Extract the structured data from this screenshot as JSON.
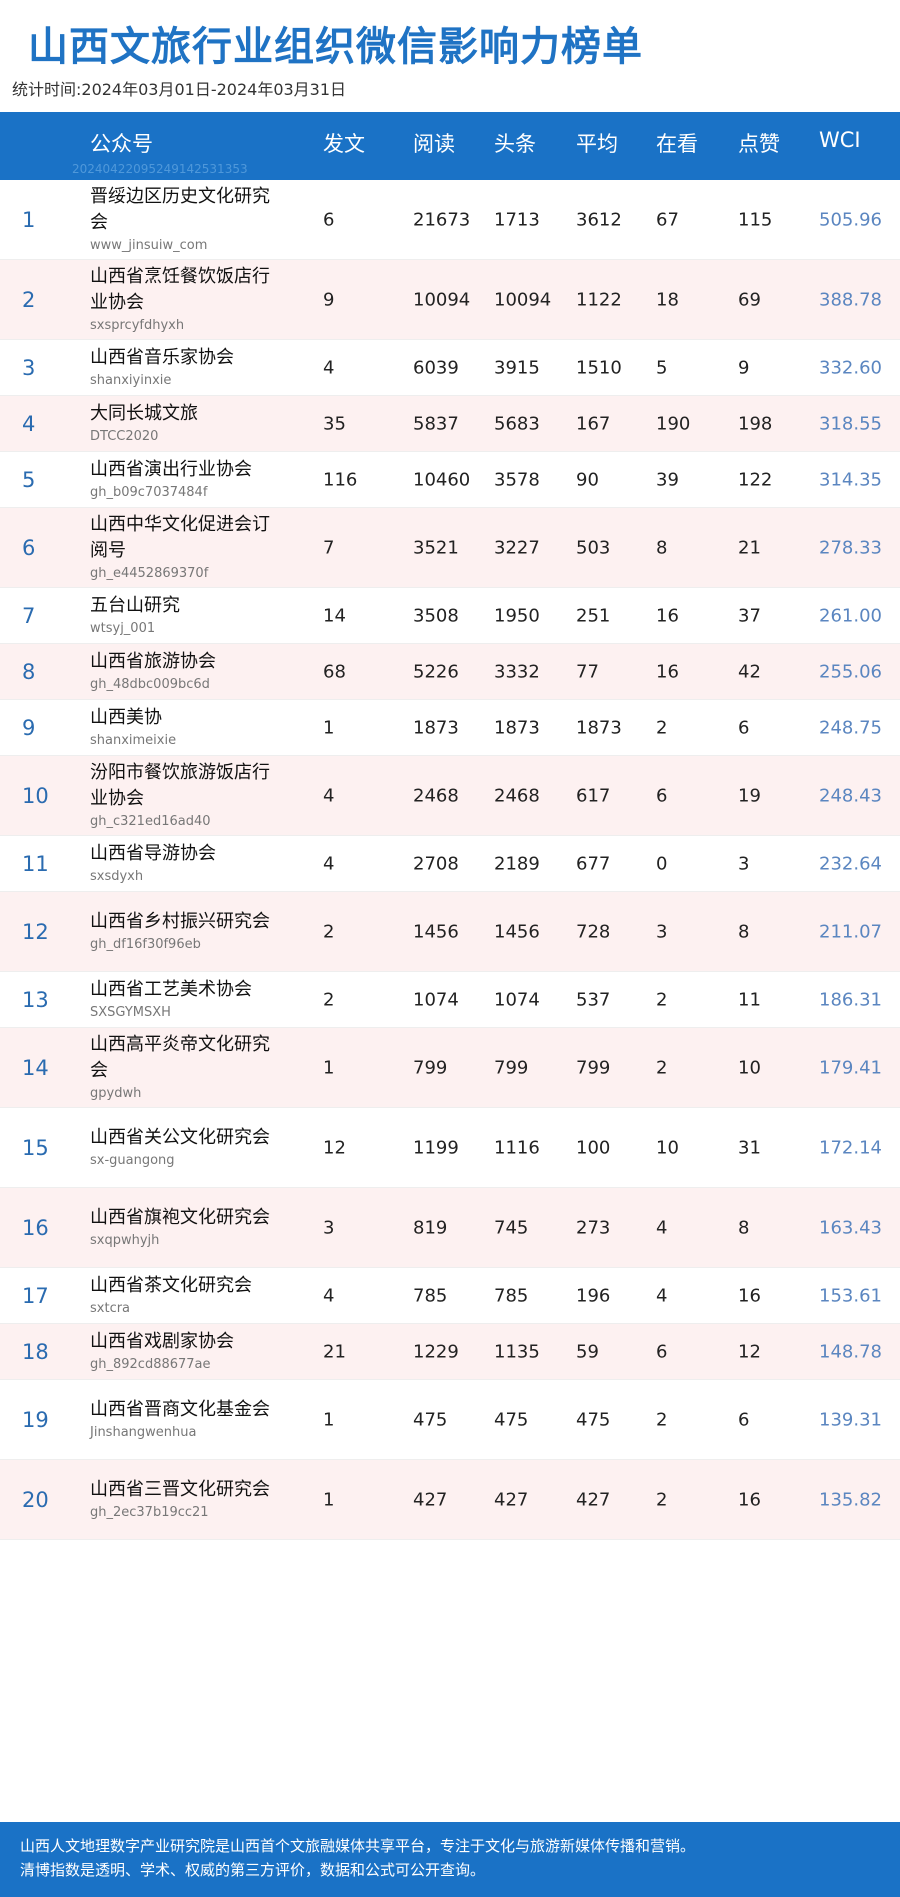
{
  "header": {
    "title": "山西文旅行业组织微信影响力榜单",
    "period": "统计时间:2024年03月01日-2024年03月31日"
  },
  "table": {
    "columns": {
      "account": "公众号",
      "posts": "发文",
      "reads": "阅读",
      "headline": "头条",
      "average": "平均",
      "watching": "在看",
      "likes": "点赞",
      "wci": "WCI"
    },
    "header_id": "20240422095249142531353",
    "rows": [
      {
        "rank": "1",
        "name": "晋绥边区历史文化研究会",
        "account": "www_jinsuiw_com",
        "posts": "6",
        "reads": "21673",
        "headline": "1713",
        "average": "3612",
        "watching": "67",
        "likes": "115",
        "wci": "505.96"
      },
      {
        "rank": "2",
        "name": "山西省烹饪餐饮饭店行业协会",
        "account": "sxsprcyfdhyxh",
        "posts": "9",
        "reads": "10094",
        "headline": "10094",
        "average": "1122",
        "watching": "18",
        "likes": "69",
        "wci": "388.78"
      },
      {
        "rank": "3",
        "name": "山西省音乐家协会",
        "account": "shanxiyinxie",
        "posts": "4",
        "reads": "6039",
        "headline": "3915",
        "average": "1510",
        "watching": "5",
        "likes": "9",
        "wci": "332.60"
      },
      {
        "rank": "4",
        "name": "大同长城文旅",
        "account": "DTCC2020",
        "posts": "35",
        "reads": "5837",
        "headline": "5683",
        "average": "167",
        "watching": "190",
        "likes": "198",
        "wci": "318.55"
      },
      {
        "rank": "5",
        "name": "山西省演出行业协会",
        "account": "gh_b09c7037484f",
        "posts": "116",
        "reads": "10460",
        "headline": "3578",
        "average": "90",
        "watching": "39",
        "likes": "122",
        "wci": "314.35"
      },
      {
        "rank": "6",
        "name": "山西中华文化促进会订阅号",
        "account": "gh_e4452869370f",
        "posts": "7",
        "reads": "3521",
        "headline": "3227",
        "average": "503",
        "watching": "8",
        "likes": "21",
        "wci": "278.33"
      },
      {
        "rank": "7",
        "name": "五台山研究",
        "account": "wtsyj_001",
        "posts": "14",
        "reads": "3508",
        "headline": "1950",
        "average": "251",
        "watching": "16",
        "likes": "37",
        "wci": "261.00"
      },
      {
        "rank": "8",
        "name": "山西省旅游协会",
        "account": "gh_48dbc009bc6d",
        "posts": "68",
        "reads": "5226",
        "headline": "3332",
        "average": "77",
        "watching": "16",
        "likes": "42",
        "wci": "255.06"
      },
      {
        "rank": "9",
        "name": "山西美协",
        "account": "shanximeixie",
        "posts": "1",
        "reads": "1873",
        "headline": "1873",
        "average": "1873",
        "watching": "2",
        "likes": "6",
        "wci": "248.75"
      },
      {
        "rank": "10",
        "name": "汾阳市餐饮旅游饭店行业协会",
        "account": "gh_c321ed16ad40",
        "posts": "4",
        "reads": "2468",
        "headline": "2468",
        "average": "617",
        "watching": "6",
        "likes": "19",
        "wci": "248.43"
      },
      {
        "rank": "11",
        "name": "山西省导游协会",
        "account": "sxsdyxh",
        "posts": "4",
        "reads": "2708",
        "headline": "2189",
        "average": "677",
        "watching": "0",
        "likes": "3",
        "wci": "232.64"
      },
      {
        "rank": "12",
        "name": "山西省乡村振兴研究会",
        "account": "gh_df16f30f96eb",
        "posts": "2",
        "reads": "1456",
        "headline": "1456",
        "average": "728",
        "watching": "3",
        "likes": "8",
        "wci": "211.07"
      },
      {
        "rank": "13",
        "name": "山西省工艺美术协会",
        "account": "SXSGYMSXH",
        "posts": "2",
        "reads": "1074",
        "headline": "1074",
        "average": "537",
        "watching": "2",
        "likes": "11",
        "wci": "186.31"
      },
      {
        "rank": "14",
        "name": "山西高平炎帝文化研究会",
        "account": "gpydwh",
        "posts": "1",
        "reads": "799",
        "headline": "799",
        "average": "799",
        "watching": "2",
        "likes": "10",
        "wci": "179.41"
      },
      {
        "rank": "15",
        "name": "山西省关公文化研究会",
        "account": "sx-guangong",
        "posts": "12",
        "reads": "1199",
        "headline": "1116",
        "average": "100",
        "watching": "10",
        "likes": "31",
        "wci": "172.14"
      },
      {
        "rank": "16",
        "name": "山西省旗袍文化研究会",
        "account": "sxqpwhyjh",
        "posts": "3",
        "reads": "819",
        "headline": "745",
        "average": "273",
        "watching": "4",
        "likes": "8",
        "wci": "163.43"
      },
      {
        "rank": "17",
        "name": "山西省茶文化研究会",
        "account": "sxtcra",
        "posts": "4",
        "reads": "785",
        "headline": "785",
        "average": "196",
        "watching": "4",
        "likes": "16",
        "wci": "153.61"
      },
      {
        "rank": "18",
        "name": "山西省戏剧家协会",
        "account": "gh_892cd88677ae",
        "posts": "21",
        "reads": "1229",
        "headline": "1135",
        "average": "59",
        "watching": "6",
        "likes": "12",
        "wci": "148.78"
      },
      {
        "rank": "19",
        "name": "山西省晋商文化基金会",
        "account": "Jinshangwenhua",
        "posts": "1",
        "reads": "475",
        "headline": "475",
        "average": "475",
        "watching": "2",
        "likes": "6",
        "wci": "139.31"
      },
      {
        "rank": "20",
        "name": "山西省三晋文化研究会",
        "account": "gh_2ec37b19cc21",
        "posts": "1",
        "reads": "427",
        "headline": "427",
        "average": "427",
        "watching": "2",
        "likes": "16",
        "wci": "135.82"
      }
    ]
  },
  "footer": {
    "line1": "山西人文地理数字产业研究院是山西首个文旅融媒体共享平台，专注于文化与旅游新媒体传播和营销。",
    "line2": "清博指数是透明、学术、权威的第三方评价，数据和公式可公开查询。"
  },
  "colors": {
    "accent": "#1a72c6",
    "title": "#1f73c4",
    "row_alt": "#fdf1f1",
    "wci": "#5b86c0"
  }
}
